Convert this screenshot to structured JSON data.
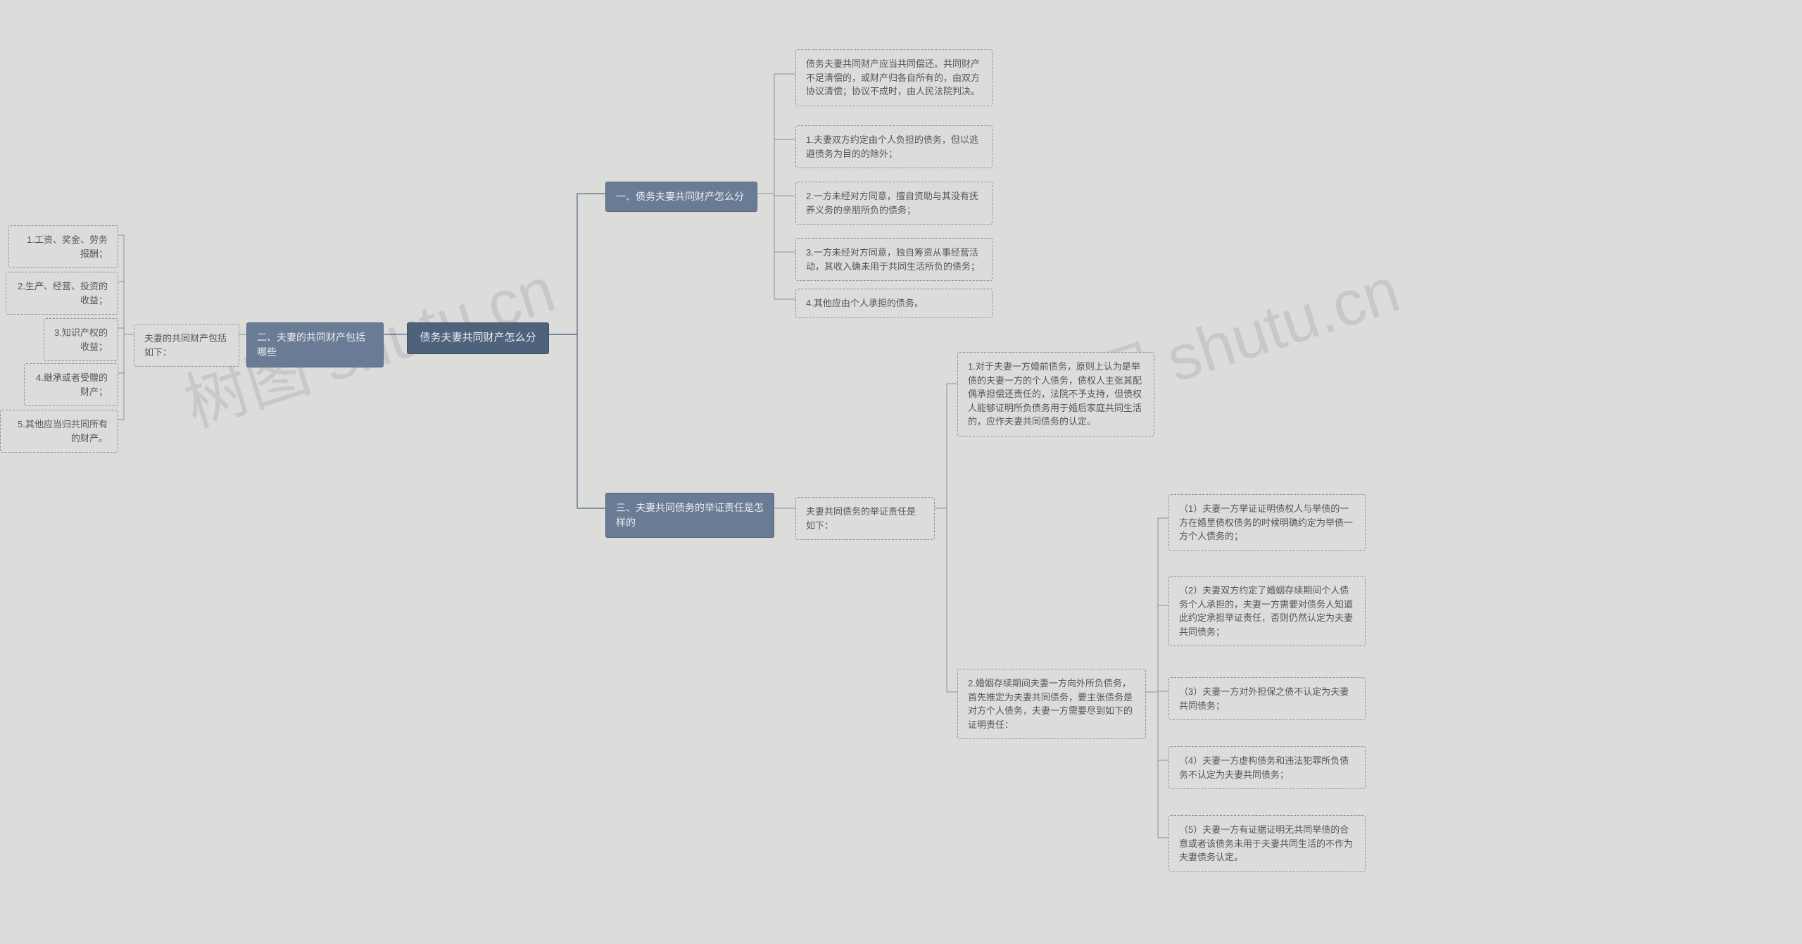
{
  "root": "债务夫妻共同财产怎么分",
  "branch1": {
    "title": "一、债务夫妻共同财产怎么分",
    "items": [
      "债务夫妻共同财产应当共同偿还。共同财产不足清偿的，或财产归各自所有的，由双方协议清偿；协议不成时，由人民法院判决。",
      "1.夫妻双方约定由个人负担的债务，但以逃避债务为目的的除外；",
      "2.一方未经对方同意，擅自资助与其没有抚养义务的亲朋所负的债务；",
      "3.一方未经对方同意，独自筹资从事经营活动，其收入确未用于共同生活所负的债务；",
      "4.其他应由个人承担的债务。"
    ]
  },
  "branch2": {
    "title": "二、夫妻的共同财产包括哪些",
    "sub": "夫妻的共同财产包括如下：",
    "items": [
      "1.工资、奖金、劳务报酬；",
      "2.生产、经营、投资的收益；",
      "3.知识产权的收益；",
      "4.继承或者受赠的财产；",
      "5.其他应当归共同所有的财产。"
    ]
  },
  "branch3": {
    "title": "三、夫妻共同债务的举证责任是怎样的",
    "sub": "夫妻共同债务的举证责任是如下：",
    "items": [
      "1.对于夫妻一方婚前债务，原则上认为是举债的夫妻一方的个人债务，债权人主张其配偶承担偿还责任的，法院不予支持，但债权人能够证明所负债务用于婚后家庭共同生活的，应作夫妻共同债务的认定。",
      "2.婚姻存续期间夫妻一方向外所负债务，首先推定为夫妻共同债务，要主张债务是对方个人债务，夫妻一方需要尽到如下的证明责任："
    ],
    "sub2items": [
      "（1）夫妻一方举证证明债权人与举债的一方在婚里债权债务的时候明确约定为举债一方个人债务的；",
      "（2）夫妻双方约定了婚姻存续期间个人债务个人承担的，夫妻一方需要对债务人知道此约定承担举证责任，否则仍然认定为夫妻共同债务；",
      "（3）夫妻一方对外担保之债不认定为夫妻共同债务；",
      "（4）夫妻一方虚构债务和违法犯罪所负债务不认定为夫妻共同债务；",
      "（5）夫妻一方有证据证明无共同举债的合意或者该债务未用于夫妻共同生活的不作为夫妻债务认定。"
    ]
  },
  "watermark": "树图 shutu.cn"
}
